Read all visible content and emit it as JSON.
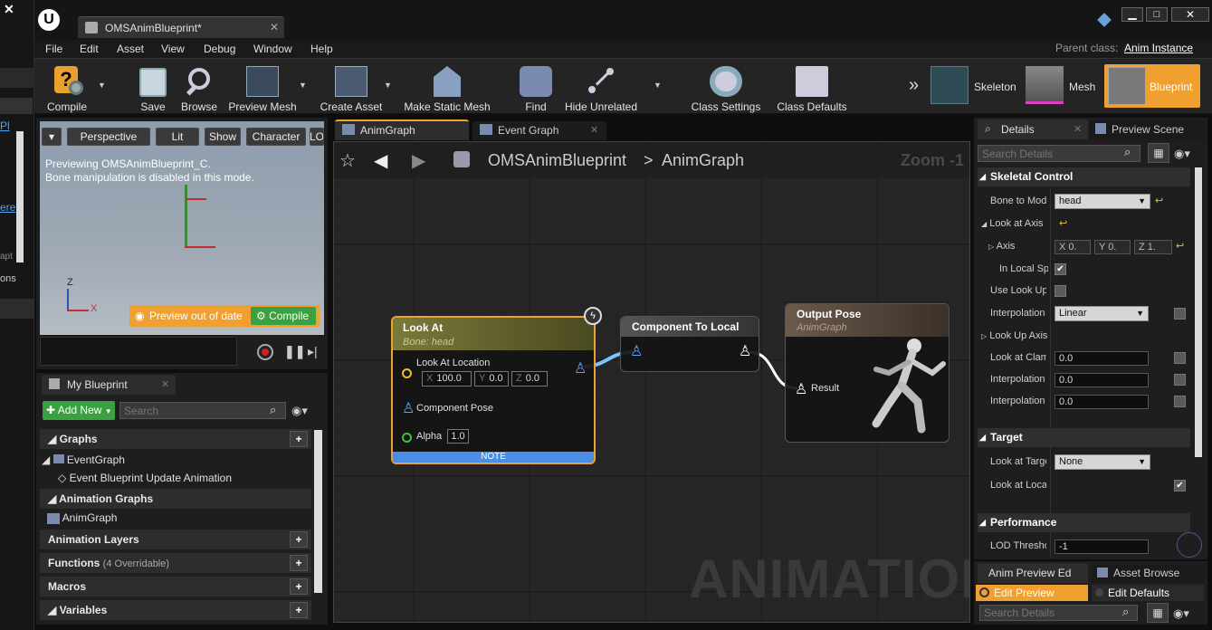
{
  "window": {
    "tab_title": "OMSAnimBlueprint*",
    "parent_class_label": "Parent class:",
    "parent_class_value": "Anim Instance"
  },
  "menu": [
    "File",
    "Edit",
    "Asset",
    "View",
    "Debug",
    "Window",
    "Help"
  ],
  "toolbar": {
    "compile": "Compile",
    "save": "Save",
    "browse": "Browse",
    "preview_mesh": "Preview Mesh",
    "create_asset": "Create Asset",
    "make_static_mesh": "Make Static Mesh",
    "find": "Find",
    "hide_unrelated": "Hide Unrelated",
    "class_settings": "Class Settings",
    "class_defaults": "Class Defaults",
    "skeleton": "Skeleton",
    "mesh": "Mesh",
    "blueprint": "Blueprint"
  },
  "viewport": {
    "perspective": "Perspective",
    "lit": "Lit",
    "show": "Show",
    "character": "Character",
    "lod": "LO",
    "preview_line1": "Previewing OMSAnimBlueprint_C.",
    "preview_line2": "Bone manipulation is disabled in this mode.",
    "preview_out_of_date": "Preview out of date",
    "compile": "Compile"
  },
  "my_blueprint": {
    "tab": "My Blueprint",
    "add_new": "Add New",
    "search_placeholder": "Search",
    "graphs": "Graphs",
    "event_graph": "EventGraph",
    "event_update": "Event Blueprint Update Animation",
    "animation_graphs": "Animation Graphs",
    "anim_graph": "AnimGraph",
    "animation_layers": "Animation Layers",
    "functions": "Functions",
    "functions_count": "(4 Overridable)",
    "macros": "Macros",
    "variables": "Variables"
  },
  "graph": {
    "tab_anim": "AnimGraph",
    "tab_event": "Event Graph",
    "breadcrumb_bp": "OMSAnimBlueprint",
    "breadcrumb_sep": ">",
    "breadcrumb_graph": "AnimGraph",
    "zoom": "Zoom -1",
    "watermark": "ANIMATION"
  },
  "nodes": {
    "look_at": {
      "title": "Look At",
      "subtitle": "Bone: head",
      "pin_location": "Look At Location",
      "x_label": "X",
      "x": "100.0",
      "y_label": "Y",
      "y": "0.0",
      "z_label": "Z",
      "z": "0.0",
      "pin_pose": "Component Pose",
      "pin_alpha": "Alpha",
      "alpha": "1.0",
      "note": "NOTE"
    },
    "component_to_local": {
      "title": "Component To Local"
    },
    "output_pose": {
      "title": "Output Pose",
      "subtitle": "AnimGraph",
      "pin_result": "Result"
    }
  },
  "details": {
    "tab": "Details",
    "tab_preview": "Preview Scene",
    "search_placeholder": "Search Details",
    "skeletal_control": "Skeletal Control",
    "bone_to_modify": "Bone to Mod",
    "bone_value": "head",
    "look_at_axis": "Look at Axis",
    "axis": "Axis",
    "axis_x": "X 0.",
    "axis_y": "Y 0.",
    "axis_z": "Z 1.",
    "in_local_space": "In Local Sp",
    "use_look_up": "Use Look Up",
    "interpolation": "Interpolation",
    "interp_value": "Linear",
    "look_up_axis": "Look Up Axis",
    "look_at_clamp": "Look at Clam",
    "clamp_value": "0.0",
    "interp2": "Interpolation",
    "interp2_value": "0.0",
    "interp3": "Interpolation",
    "interp3_value": "0.0",
    "target": "Target",
    "look_at_target": "Look at Targe",
    "target_value": "None",
    "look_at_location": "Look at Loca",
    "performance": "Performance",
    "lod_threshold": "LOD Thresho",
    "lod_value": "-1"
  },
  "bottom_right": {
    "tab_anim_preview": "Anim Preview Ed",
    "tab_asset_browser": "Asset Browse",
    "edit_preview": "Edit Preview",
    "edit_defaults": "Edit Defaults",
    "search_placeholder": "Search Details"
  },
  "left_strip": {
    "text1": "Pl",
    "text2": "ere",
    "text3": "apt",
    "text4": "ons"
  },
  "colors": {
    "accent": "#f2a93b",
    "blue_pin": "#58a6ff",
    "note_bar": "#4a8ee8"
  }
}
